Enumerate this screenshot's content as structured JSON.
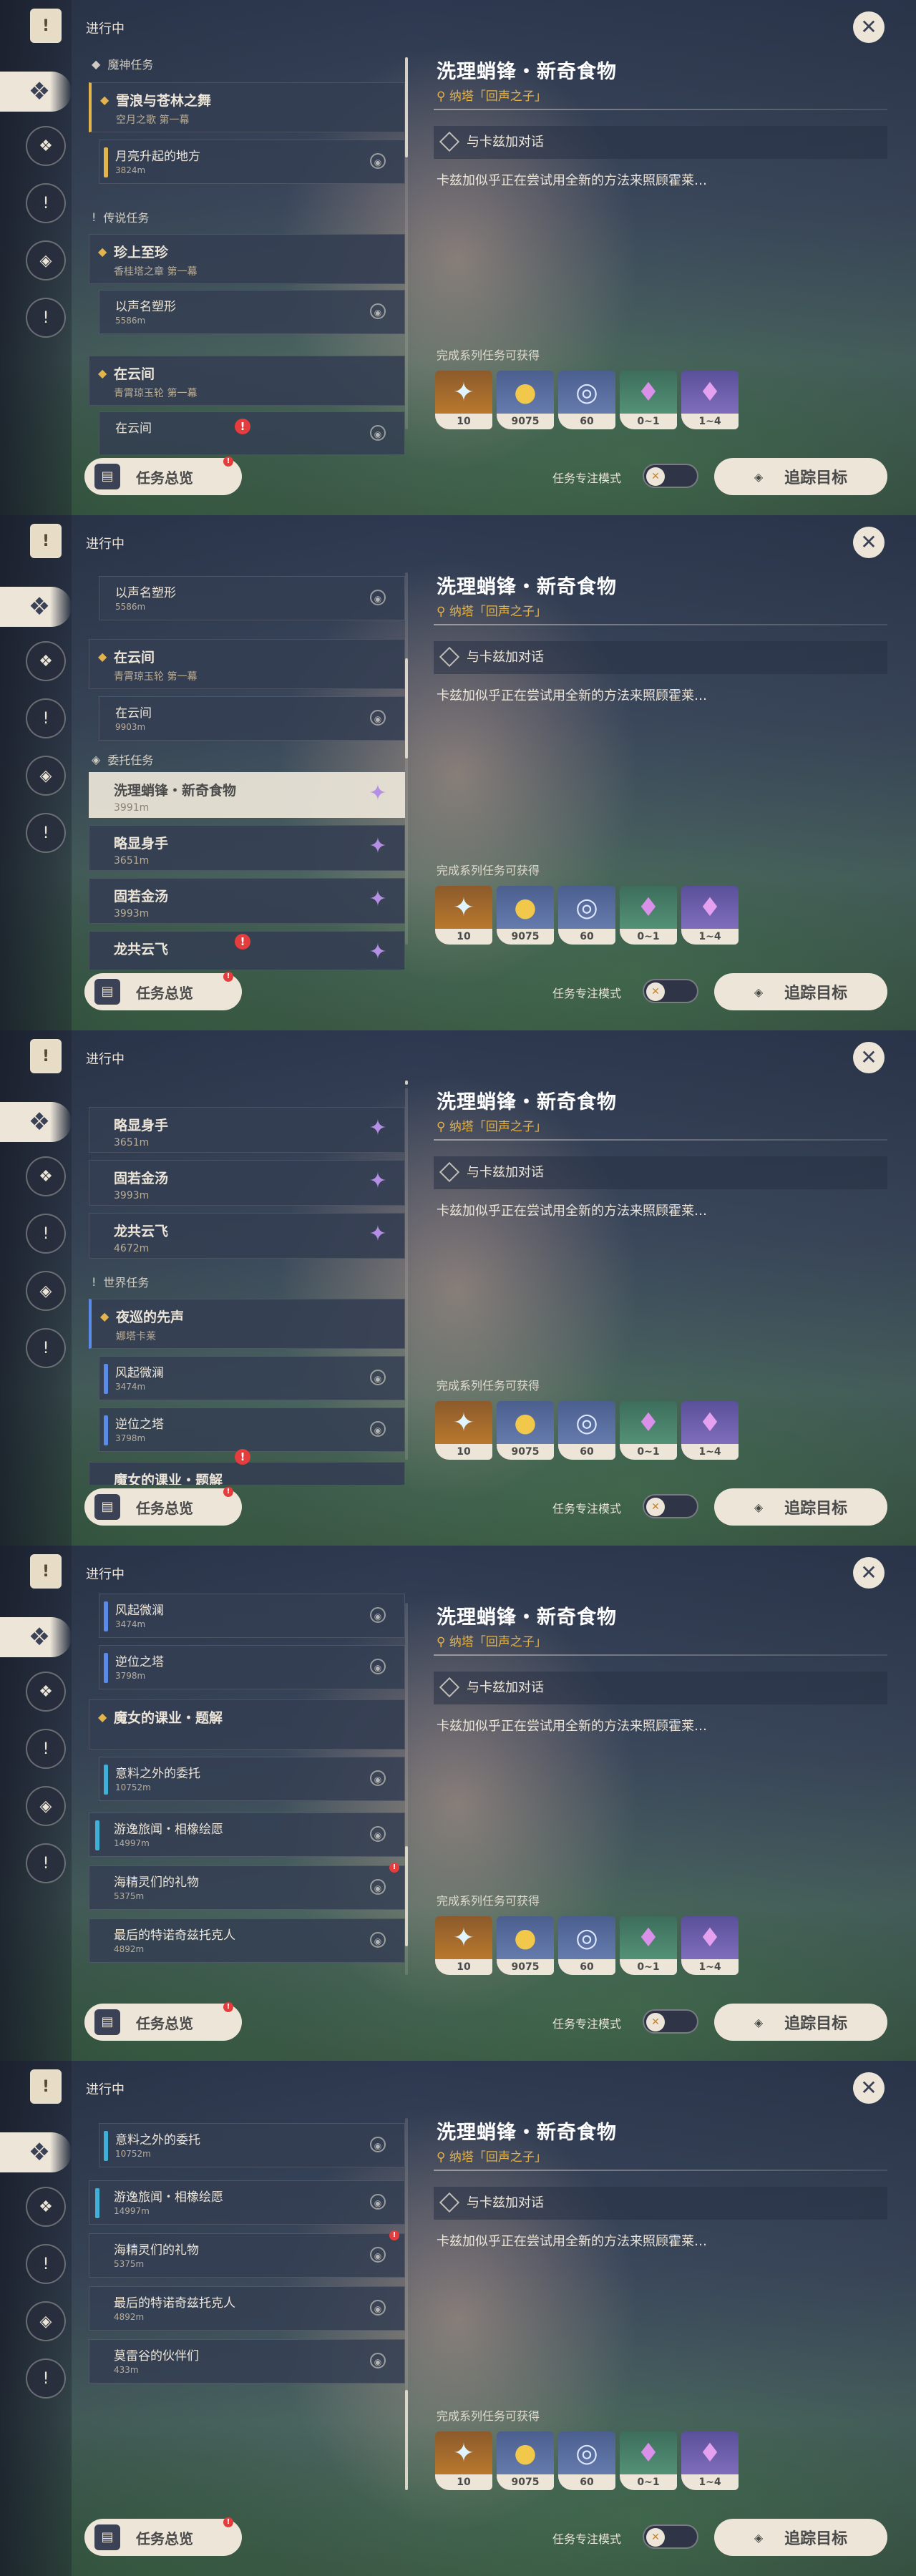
{
  "ui": {
    "tab_title": "进行中",
    "overview_label": "任务总览",
    "focus_mode_label": "任务专注模式",
    "track_label": "追踪目标",
    "close_symbol": "✕"
  },
  "detail": {
    "title": "洗理蛸锋・新奇食物",
    "location": "纳塔「回声之子」",
    "objective": "与卡兹加对话",
    "description": "卡兹加似乎正在尝试用全新的方法来照顾霍莱…",
    "rewards_label": "完成系列任务可获得",
    "rewards": [
      {
        "icon": "adventure-exp-icon",
        "count": "10"
      },
      {
        "icon": "mora-icon",
        "count": "9075"
      },
      {
        "icon": "companionship-exp-icon",
        "count": "60"
      },
      {
        "icon": "green-crystal-icon",
        "count": "0~1"
      },
      {
        "icon": "purple-crystal-icon",
        "count": "1~4"
      }
    ]
  },
  "quests": {
    "archon_header": "魔神任务",
    "legend_header": "传说任务",
    "commission_header": "委托任务",
    "world_header": "世界任务",
    "q1_title": "雪浪与苍林之舞",
    "q1_sub": "空月之歌 第一幕",
    "q1_step_title": "月亮升起的地方",
    "q1_step_dist": "3824m",
    "q2_title": "珍上至珍",
    "q2_sub": "香桂塔之章 第一幕",
    "q2_step_title": "以声名塑形",
    "q2_step_dist": "5586m",
    "q3_title": "在云间",
    "q3_sub": "青霄琼玉轮 第一幕",
    "q3_step_title": "在云间",
    "q3_step_dist": "9903m",
    "c1_title": "洗理蛸锋・新奇食物",
    "c1_dist": "3991m",
    "c2_title": "略显身手",
    "c2_dist": "3651m",
    "c3_title": "固若金汤",
    "c3_dist": "3993m",
    "c4_title": "龙共云飞",
    "c4_dist": "4672m",
    "w1_title": "夜巡的先声",
    "w1_sub": "娜塔卡莱",
    "w1_s1_title": "风起微澜",
    "w1_s1_dist": "3474m",
    "w1_s2_title": "逆位之塔",
    "w1_s2_dist": "3798m",
    "w2_title": "魔女的课业・题解",
    "w2_s1_title": "意料之外的委托",
    "w2_s1_dist": "10752m",
    "w3_title": "游逸旅闻・相橡绘愿",
    "w3_dist": "14997m",
    "w4_title": "海精灵们的礼物",
    "w4_dist": "5375m",
    "w5_title": "最后的特诺奇兹托克人",
    "w5_dist": "4892m",
    "w6_title": "莫雷谷的伙伴们",
    "w6_dist": "433m"
  }
}
